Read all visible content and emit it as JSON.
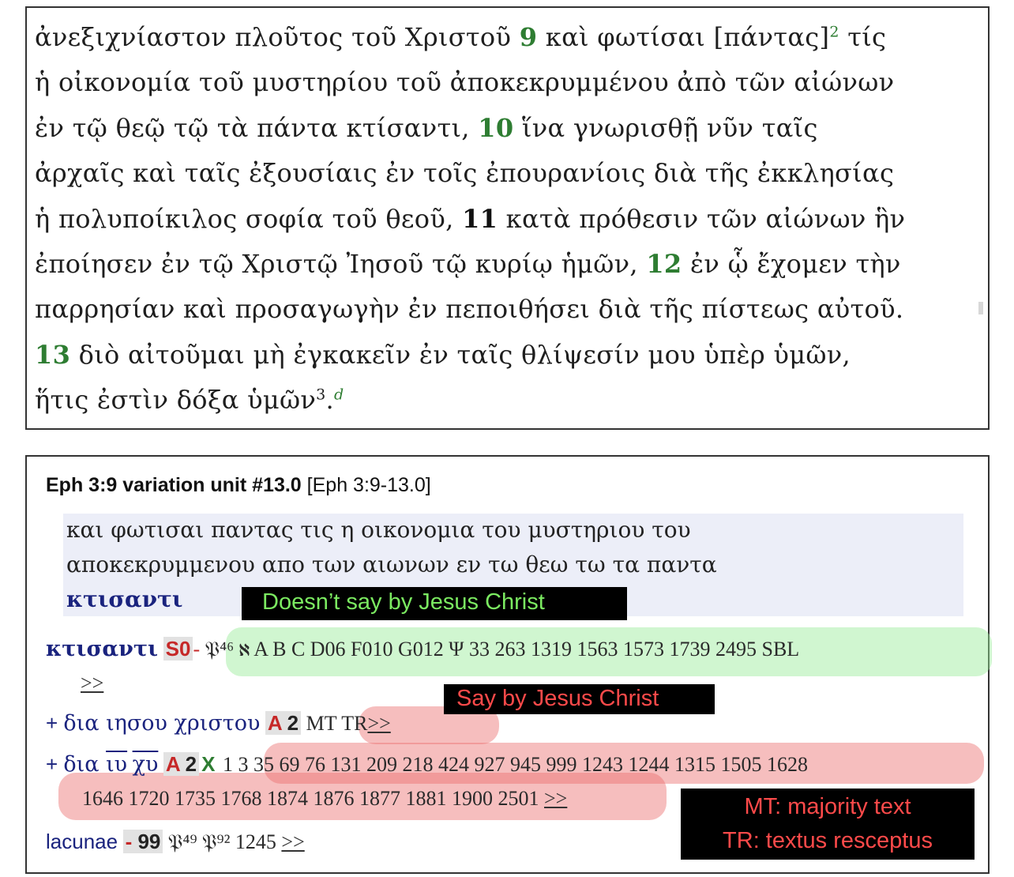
{
  "greek_text": {
    "line1": {
      "t1": "ἀνεξιχνίαστον πλοῦτος τοῦ Χριστοῦ ",
      "v9": "9",
      "t2": " καὶ φωτίσαι [πάντας]",
      "fn2": "2",
      "t3": " τίς"
    },
    "line2": "ἡ οἰκονομία τοῦ μυστηρίου τοῦ ἀποκεκρυμμένου ἀπὸ τῶν αἰώνων",
    "line3": {
      "t1": "ἐν τῷ θεῷ τῷ τὰ πάντα κτίσαντι, ",
      "v10": "10",
      "t2": " ἵνα γνωρισθῇ νῦν ταῖς"
    },
    "line4": "ἀρχαῖς καὶ ταῖς ἐξουσίαις ἐν τοῖς ἐπουρανίοις διὰ τῆς ἐκκλησίας",
    "line5": {
      "t1": "ἡ πολυποίκιλος σοφία τοῦ θεοῦ, ",
      "v11": "11",
      "t2": " κατὰ πρόθεσιν τῶν αἰώνων ἣν"
    },
    "line6": {
      "t1": "ἐποίησεν ἐν τῷ Χριστῷ Ἰησοῦ τῷ κυρίῳ ἡμῶν, ",
      "v12": "12",
      "t2": " ἐν ᾧ ἔχομεν τὴν"
    },
    "line7": "παρρησίαν καὶ προσαγωγὴν ἐν πεποιθήσει διὰ τῆς πίστεως αὐτοῦ.",
    "line8": {
      "v13": "13",
      "t1": " διὸ αἰτοῦμαι μὴ ἐγκακεῖν ἐν ταῖς θλίψεσίν μου ὑπὲρ ὑμῶν,"
    },
    "line9": {
      "t1": "ἥτις ἐστὶν δόξα ὑμῶν",
      "fn3": "3",
      "t2": ".",
      "note_d": "d"
    }
  },
  "apparatus": {
    "header_bold": "Eph 3:9 variation unit #13.0",
    "header_ref": " [Eph 3:9-13.0]",
    "lemma": {
      "line1": "και φωτισαι παντας τις η οικονομια του μυστηριου του",
      "line2": "αποκεκρυμμενου απο των αιωνων εν τω θεω τω τα παντα",
      "line3": "κτισαντι"
    },
    "readings": {
      "r1": {
        "greek": "κτισαντι",
        "siglum": "S0",
        "dash": "-",
        "witnesses": "𝔓⁴⁶ ℵ A B C D06 F010 G012 Ψ 33 263 1319 1563 1573 1739 2495 SBL",
        "more": ">>"
      },
      "r2": {
        "plus": "+ ",
        "greek": "δια ιησου χριστου",
        "siglum_a": "A",
        "siglum_n": "2",
        "witnesses": "MT TR",
        "more": ">>"
      },
      "r3": {
        "plus": "+ ",
        "greek_pre": "δια ",
        "nomen1": "ιυ",
        "nomen2": "χυ",
        "siglum_a": "A",
        "siglum_n": "2",
        "siglum_x": "X",
        "witnesses1": "1 3 35 69 76 131 209 218 424 927 945 999 1243 1244 1315 1505 1628",
        "witnesses2": "1646 1720 1735 1768 1874 1876 1877 1881 1900 2501",
        "more": ">>"
      },
      "lacunae": {
        "label": "lacunae",
        "dash": "- ",
        "count": "99",
        "witnesses": "𝔓⁴⁹ 𝔓⁹² 1245",
        "more": ">>"
      }
    }
  },
  "annotations": {
    "green_callout": "Doesn’t say by Jesus Christ",
    "red_callout": "Say by Jesus Christ",
    "mt_note": "MT: majority text",
    "tr_note": "TR: textus resceptus"
  },
  "colors": {
    "verse_green": "#2e7d32",
    "greek_blue": "#1a237e",
    "callout_green": "#7bea61",
    "callout_red": "#ff4a4a"
  }
}
